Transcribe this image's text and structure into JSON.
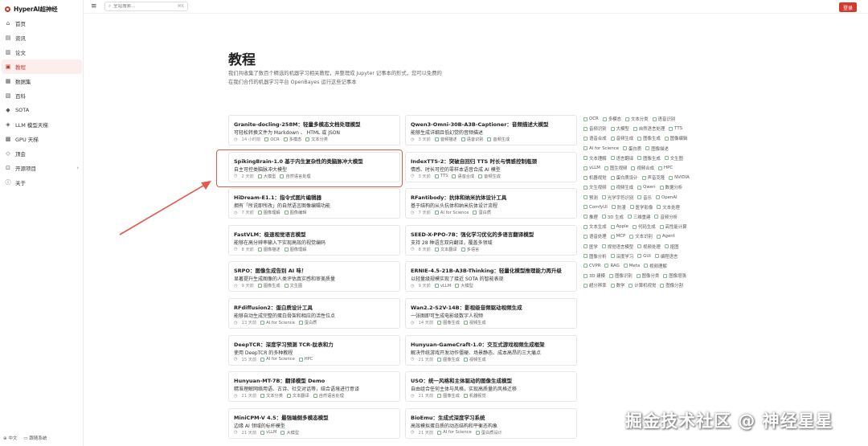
{
  "app": {
    "name": "HyperAI超神经",
    "accent": "#d23a2f"
  },
  "sidebar": {
    "items": [
      {
        "label": "首页",
        "icon": "home-icon"
      },
      {
        "label": "资讯",
        "icon": "news-icon"
      },
      {
        "label": "论文",
        "icon": "paper-icon"
      },
      {
        "label": "教程",
        "icon": "tutorial-icon",
        "active": true
      },
      {
        "label": "数据集",
        "icon": "dataset-icon"
      },
      {
        "label": "百科",
        "icon": "wiki-icon"
      },
      {
        "label": "SOTA",
        "icon": "sota-icon"
      },
      {
        "label": "LLM 模型天梯",
        "icon": "ladder-icon"
      },
      {
        "label": "GPU 天梯",
        "icon": "gpu-icon"
      },
      {
        "label": "顶会",
        "icon": "conference-icon"
      },
      {
        "label": "开源项目",
        "icon": "opensource-icon",
        "has_caret": true
      },
      {
        "label": "关于",
        "icon": "about-icon"
      }
    ],
    "footer": {
      "language": "中文",
      "theme": "跟随系统"
    }
  },
  "topbar": {
    "search_placeholder": "全站搜索...",
    "search_shortcut": "⌘K",
    "login_label": "登录"
  },
  "page": {
    "title": "教程",
    "description": "我们共收集了数百个精选的机器学习相关教程，并整理成 Jupyter 记事本的形式，您可以免费的在我们合作的机器学习平台 OpenBayes 运行这些记事本"
  },
  "tutorials": [
    {
      "title": "Granite-docling-258M：轻量多模态文档处理模型",
      "desc": "可轻松转换文件为 Markdown 、 HTML 或 JSON",
      "time": "14 小时前",
      "tags": [
        "OCR",
        "多模态",
        "文本分类"
      ]
    },
    {
      "title": "Qwen3-Omni-30B-A3B-Captioner：音频描述大模型",
      "desc": "能够生成详细且低幻觉的音频描述",
      "time": "3 天前",
      "tags": [
        "音频描述",
        "语音识别",
        "音频生成"
      ]
    },
    {
      "title": "SpikingBrain-1.0 基于内生复杂性的类脑脉冲大模型",
      "desc": "自主可控类脑脉冲大模型",
      "time": "2 天前",
      "tags": [
        "大模型",
        "自然语言处理"
      ]
    },
    {
      "title": "IndexTTS-2：突破自回归 TTS 时长与情感控制瓶颈",
      "desc": "情感、时长可控的零样本语音合成 AI 模型",
      "time": "3 天前",
      "tags": [
        "TTS",
        "语音合成",
        "音频生成"
      ]
    },
    {
      "title": "HiDream-E1.1：指令式图片编辑器",
      "desc": "拥有「所说即所改」的自然语言图像编辑功能",
      "time": "7 天前",
      "tags": [
        "图像理解",
        "图像编辑"
      ]
    },
    {
      "title": "RFantibody：抗体和纳米抗体设计工具",
      "desc": "基于结构的从头抗体和纳米抗体设计流程",
      "time": "7 天前",
      "tags": [
        "AI for Science",
        "蛋白质"
      ]
    },
    {
      "title": "FastVLM：极速视觉语言模型",
      "desc": "能够在高分辨率输入下实现高效的视觉编码",
      "time": "8 天前",
      "tags": [
        "图像描述",
        "图像理解"
      ]
    },
    {
      "title": "SEED-X-PPO-7B：强化学习优化的多语言翻译模型",
      "desc": "支持 28 种语言双向翻译，覆盖多领域",
      "time": "8 天前",
      "tags": [
        "文本翻译",
        "多语言"
      ]
    },
    {
      "title": "SRPO：图像生成告别 AI 味！",
      "desc": "显著提升生成图像的人类评估真实感和审美质量",
      "time": "9 天前",
      "tags": [
        "图像生成",
        "文生图"
      ]
    },
    {
      "title": "ERNIE-4.5-21B-A3B-Thinking：轻量化模型推理能力再升级",
      "desc": "以轻量级规模实现了接近 SOTA 的智能表现",
      "time": "9 天前",
      "tags": [
        "vLLM",
        "大模型"
      ]
    },
    {
      "title": "RFdiffusion2：蛋白质设计工具",
      "desc": "能够自动生成完整的蛋白骨架和相应的活性位点",
      "time": "13 天前",
      "tags": [
        "AI for Science",
        "蛋白质"
      ]
    },
    {
      "title": "Wan2.2-S2V-14B：影视级音频驱动视频生成",
      "desc": "一张图即可生成电影级数字人视频",
      "time": "14 天前",
      "tags": [
        "图像生成",
        "视频生成"
      ]
    },
    {
      "title": "DeepTCR：深度学习预测 TCR-肽表和力",
      "desc": "使用 DeepTCR 的多种教程",
      "time": "15 天前",
      "tags": [
        "AI for Science",
        "HPC"
      ]
    },
    {
      "title": "Hunyuan-GameCraft-1.0：交互式游戏视频生成框架",
      "desc": "解决传统游戏开发动作僵硬、场景静态、成本高昂的三大痛点",
      "time": "21 天前",
      "tags": [
        "图像生成",
        "视频生成"
      ]
    },
    {
      "title": "Hunyuan-MT-7B：翻译模型 Demo",
      "desc": "精准理解网络用语、古诗、社交对话等，结合语境进行意译",
      "time": "21 天前",
      "tags": [
        "文本分类",
        "文本翻译",
        "自然语言处理"
      ]
    },
    {
      "title": "USO：统一风格和主体驱动的图像生成模型",
      "desc": "自由组合任何主体与风格，实现高质量的风格迁移",
      "time": "21 天前",
      "tags": [
        "图像生成",
        "机器视觉"
      ]
    },
    {
      "title": "MiniCPM-V 4.5：最强端侧多模态模型",
      "desc": "边缘 AI 领域的标杆模型",
      "time": "21 天前",
      "tags": [
        "vLLM",
        "大模型"
      ]
    },
    {
      "title": "BioEmu：生成式深度学习系统",
      "desc": "高效模拟蛋白质的动态结构和平衡态构象",
      "time": "21 天前",
      "tags": [
        "AI for Science",
        "蛋白质设计"
      ]
    }
  ],
  "tag_cloud": [
    [
      "OCR",
      "多模态",
      "文本分类",
      "语音识别"
    ],
    [
      "音频识别",
      "大模型",
      "自然语言处理",
      "TTS"
    ],
    [
      "语音合成",
      "音频生成",
      "图像生成",
      "图像编辑"
    ],
    [
      "AI for Science",
      "蛋白质",
      "图像描述"
    ],
    [
      "文本理解",
      "语言翻译",
      "图像生成",
      "文生图"
    ],
    [
      "vLLM",
      "图生视频",
      "视频合成",
      "HPC"
    ],
    [
      "机器视觉",
      "蛋白质设计",
      "声音克隆",
      "NVIDIA"
    ],
    [
      "文生视频",
      "视频生成",
      "Qwen",
      "数据分析"
    ],
    [
      "预测",
      "光学字符识别",
      "音乐",
      "OpenAI"
    ],
    [
      "ComfyUI",
      "防漫",
      "医学影像",
      "文本处理"
    ],
    [
      "推理",
      "3D 生成",
      "三维重建",
      "音频分析"
    ],
    [
      "文本生成",
      "Apple",
      "代码生成",
      "高性能计算"
    ],
    [
      "语音处理",
      "MCP",
      "文本识别",
      "Agent"
    ],
    [
      "医学",
      "视觉语言模型",
      "视频处理",
      "抠图"
    ],
    [
      "图像分析",
      "深度学习",
      "GUI",
      "编程语言"
    ],
    [
      "CVPR",
      "RAG",
      "Meta",
      "视频理解"
    ],
    [
      "3D 建模",
      "图像识别",
      "图像分类",
      "图像增强"
    ],
    [
      "超分辨率",
      "数学",
      "计算机视觉",
      "图像分割"
    ]
  ],
  "watermark": "掘金技术社区 @ 神经星星"
}
